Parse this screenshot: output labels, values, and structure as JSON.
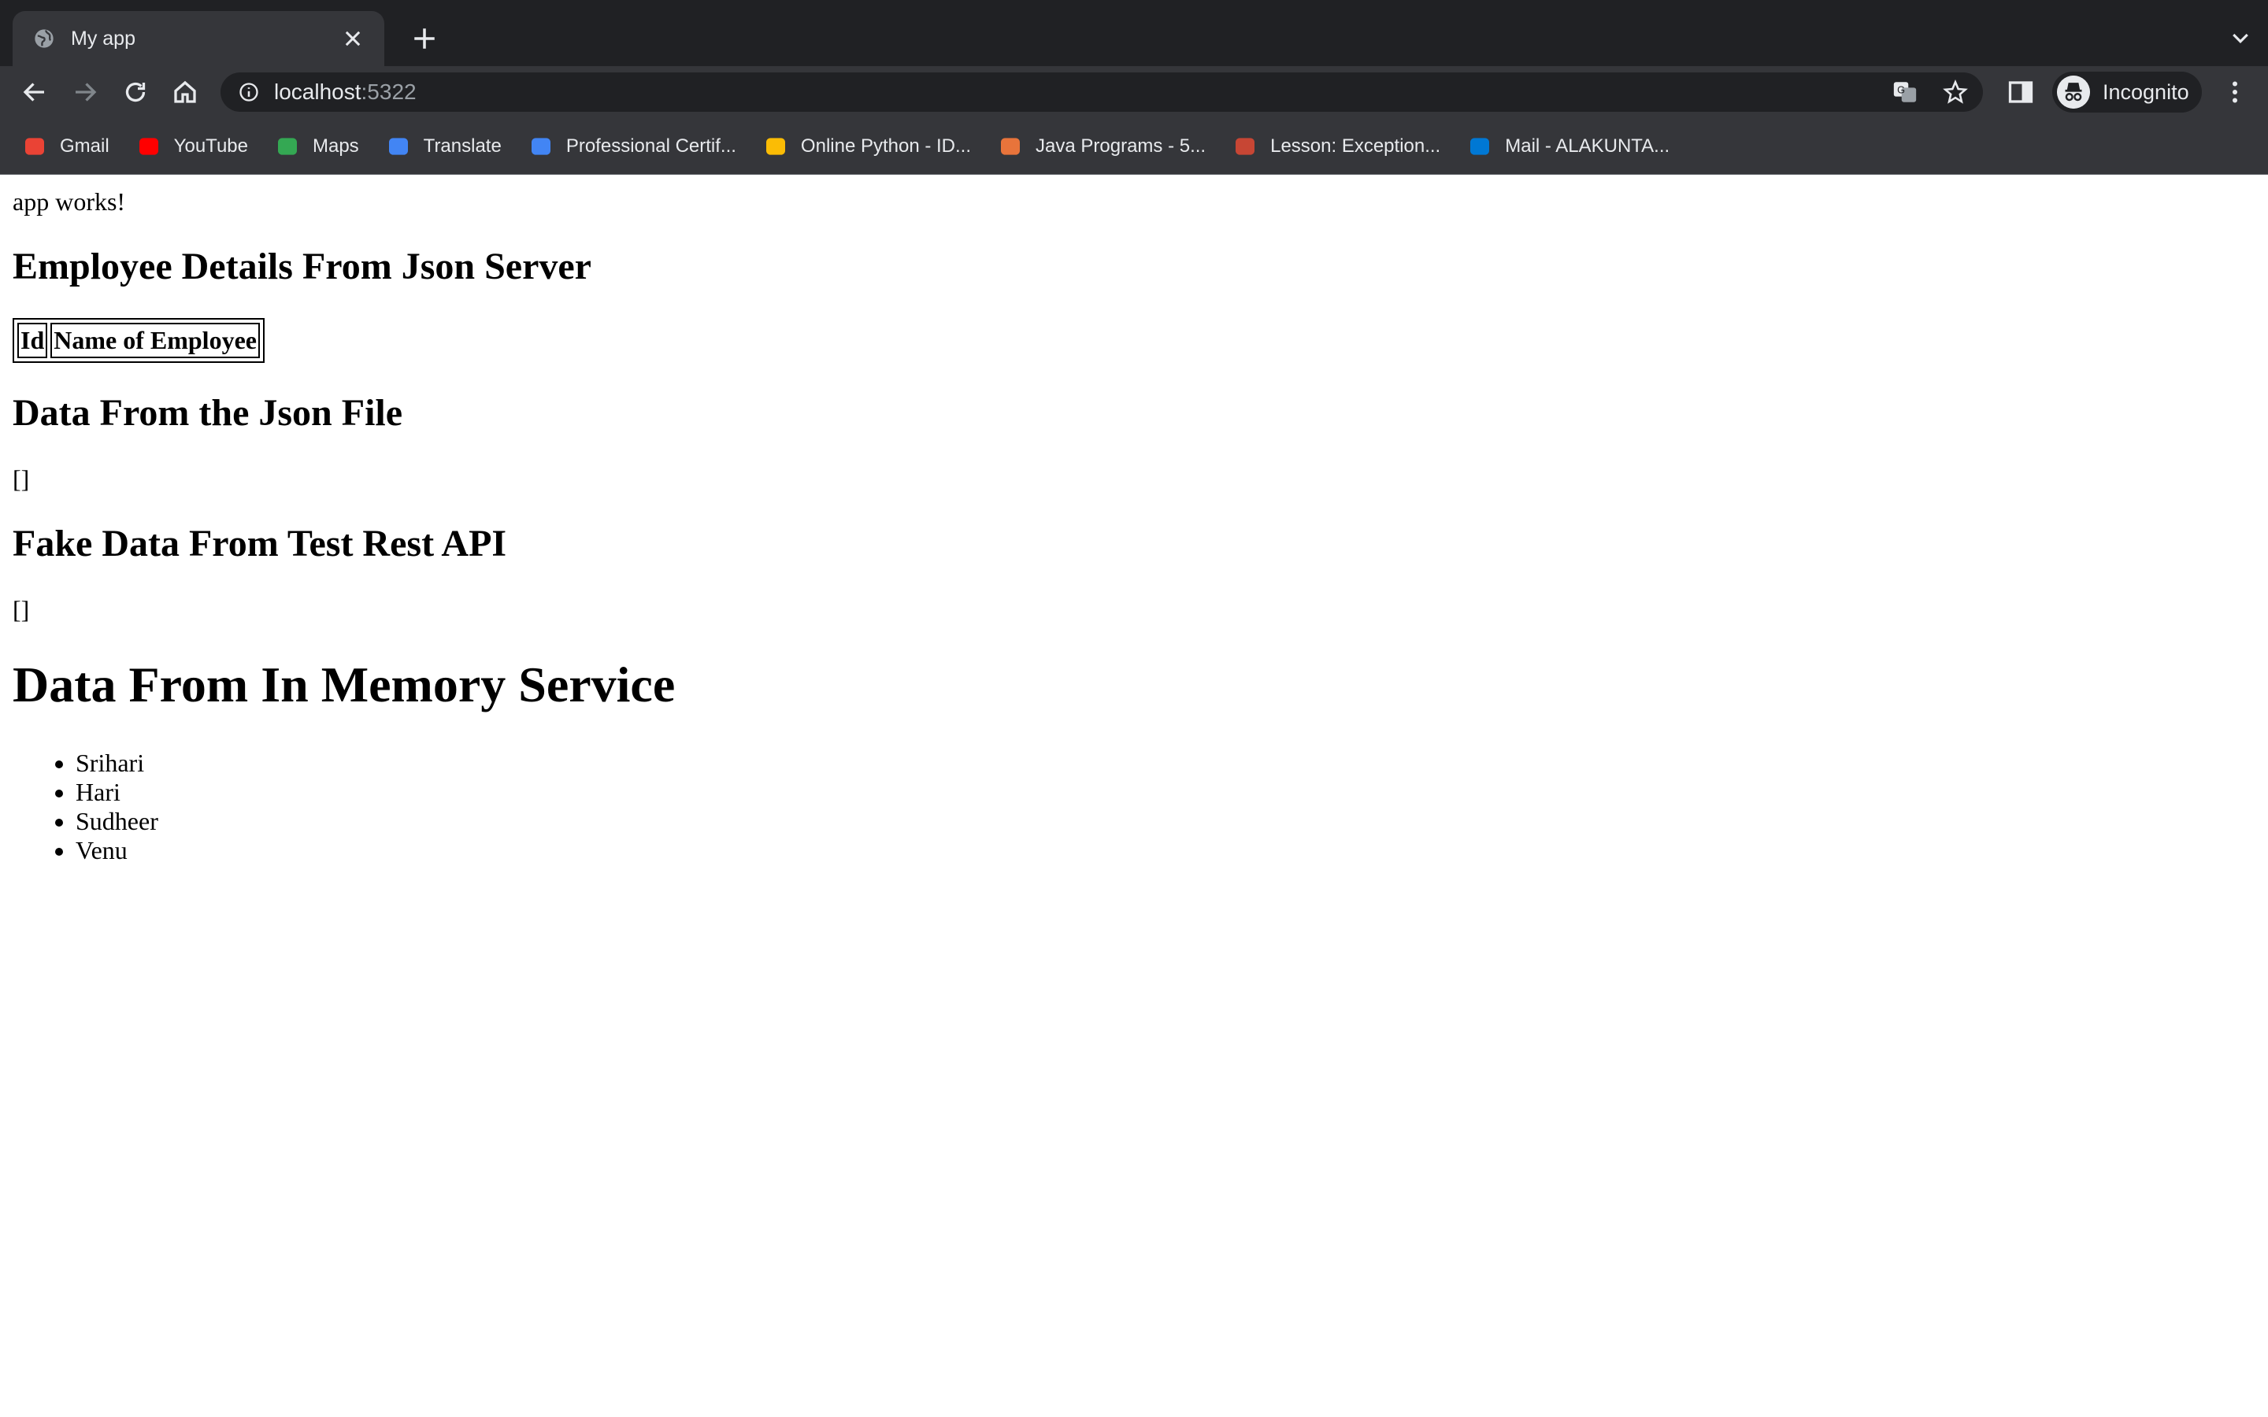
{
  "browser": {
    "tab_title": "My app",
    "url_host": "localhost",
    "url_port": ":5322",
    "profile_label": "Incognito",
    "bookmarks": [
      {
        "label": "Gmail",
        "icon": "gmail-icon",
        "color": "#ea4335"
      },
      {
        "label": "YouTube",
        "icon": "youtube-icon",
        "color": "#ff0000"
      },
      {
        "label": "Maps",
        "icon": "maps-icon",
        "color": "#34a853"
      },
      {
        "label": "Translate",
        "icon": "translate-icon",
        "color": "#4285f4"
      },
      {
        "label": "Professional Certif...",
        "icon": "google-icon",
        "color": "#4285f4"
      },
      {
        "label": "Online Python - ID...",
        "icon": "shield-icon",
        "color": "#fbbc05"
      },
      {
        "label": "Java Programs - 5...",
        "icon": "java-icon",
        "color": "#e8743b"
      },
      {
        "label": "Lesson: Exception...",
        "icon": "oracle-icon",
        "color": "#c74634"
      },
      {
        "label": "Mail - ALAKUNTA...",
        "icon": "outlook-icon",
        "color": "#0078d4"
      }
    ]
  },
  "page": {
    "intro": "app works!",
    "heading_json_server": "Employee Details From Json Server",
    "table_headers": [
      "Id",
      "Name of Employee"
    ],
    "heading_json_file": "Data From the Json File",
    "json_file_value": "[]",
    "heading_fake_api": "Fake Data From Test Rest API",
    "fake_api_value": "[]",
    "heading_in_memory": "Data From In Memory Service",
    "employees": [
      "Srihari",
      "Hari",
      "Sudheer",
      "Venu"
    ]
  }
}
